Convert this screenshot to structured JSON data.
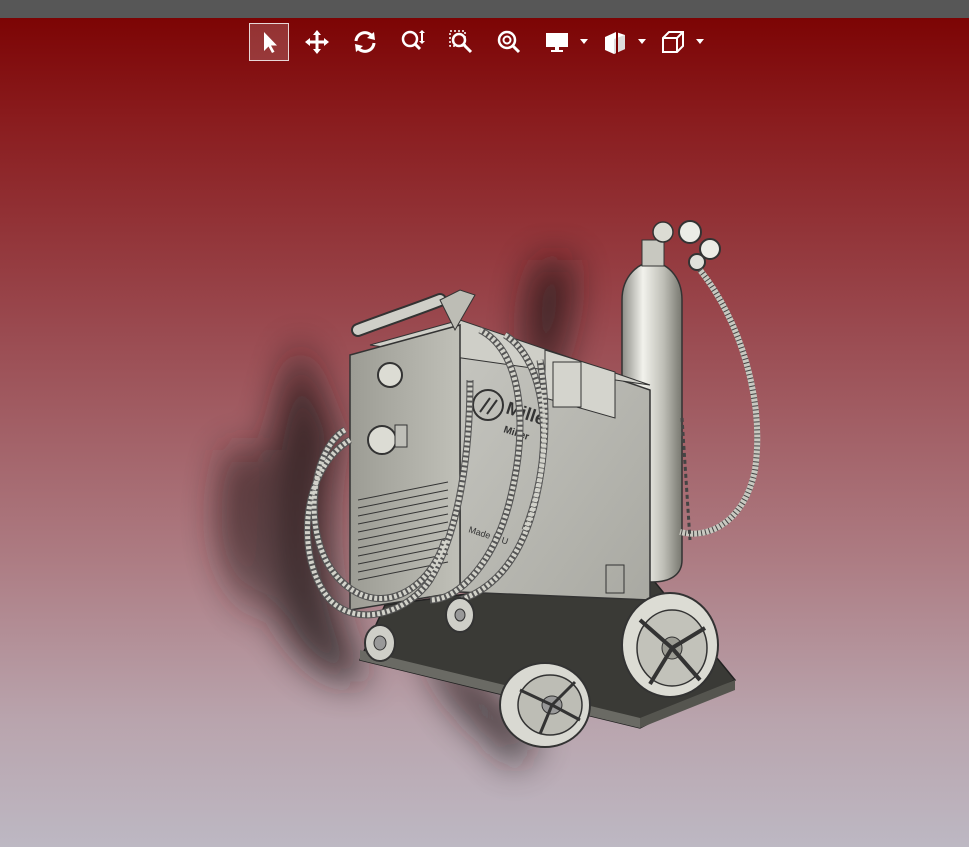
{
  "viewer": {
    "toolbar": {
      "tools": [
        {
          "id": "select",
          "icon": "select-arrow-icon",
          "active": true
        },
        {
          "id": "pan",
          "icon": "pan-move-icon"
        },
        {
          "id": "rotate",
          "icon": "rotate-icon"
        },
        {
          "id": "zoom",
          "icon": "zoom-in-out-icon"
        },
        {
          "id": "zoom-window",
          "icon": "zoom-window-icon"
        },
        {
          "id": "zoom-fit",
          "icon": "zoom-fit-icon"
        },
        {
          "id": "display-mode",
          "icon": "display-monitor-icon",
          "dropdown": true
        },
        {
          "id": "section-view",
          "icon": "section-view-icon",
          "dropdown": true
        },
        {
          "id": "view-orientation",
          "icon": "view-cube-icon",
          "dropdown": true
        }
      ]
    },
    "colors": {
      "header_bar": "#575757",
      "background_top": "#7a0000",
      "background_bottom": "#bdb8c3",
      "icon": "#ffffff"
    },
    "model": {
      "name": "welder-on-cart-model",
      "brand_text": "Miller",
      "brand_text_short": "Mille",
      "made_in_text": "Made in U"
    }
  }
}
